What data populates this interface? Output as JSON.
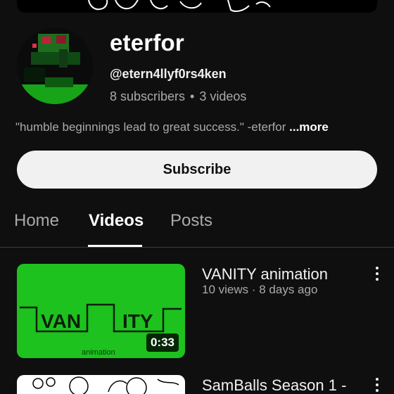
{
  "channel": {
    "name": "eterfor",
    "handle": "@etern4llyf0rs4ken",
    "subscribers": "8 subscribers",
    "video_count": "3 videos",
    "separator": "•",
    "description": "\"humble beginnings lead to great success.\" -eterfor",
    "more_label": "...more"
  },
  "subscribe_label": "Subscribe",
  "tabs": [
    {
      "label": "Home",
      "active": false
    },
    {
      "label": "Videos",
      "active": true
    },
    {
      "label": "Posts",
      "active": false
    }
  ],
  "videos": [
    {
      "title": "VANITY animation",
      "meta": "10 views · 8 days ago",
      "duration": "0:33",
      "thumb_text_left": "VAN",
      "thumb_text_right": "ITY",
      "thumb_caption": "animation"
    },
    {
      "title": "SamBalls Season 1 -"
    }
  ],
  "colors": {
    "background": "#0f0f0f",
    "subscribe_bg": "#f1f1f1",
    "thumb_green": "#1ec21e"
  }
}
